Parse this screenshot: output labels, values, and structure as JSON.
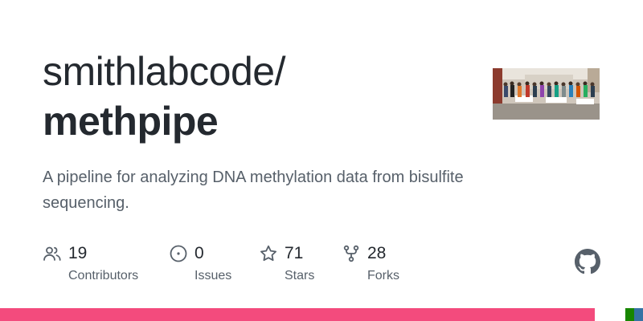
{
  "repo": {
    "owner": "smithlabcode/",
    "name": "methpipe",
    "description": "A pipeline for analyzing DNA methylation data from bisulfite sequencing."
  },
  "stats": [
    {
      "icon": "people-icon",
      "count": "19",
      "label": "Contributors"
    },
    {
      "icon": "issue-circle-icon",
      "count": "0",
      "label": "Issues"
    },
    {
      "icon": "star-icon",
      "count": "71",
      "label": "Stars"
    },
    {
      "icon": "fork-icon",
      "count": "28",
      "label": "Forks"
    }
  ],
  "languages": [
    {
      "color": "#f34b7d",
      "share": 0.925
    },
    {
      "color": "#ffffff",
      "share": 0.047
    },
    {
      "color": "#178600",
      "share": 0.014
    },
    {
      "color": "#3572A5",
      "share": 0.014
    }
  ],
  "colors": {
    "title": "#24292f",
    "muted": "#57606a",
    "background": "#ffffff"
  }
}
